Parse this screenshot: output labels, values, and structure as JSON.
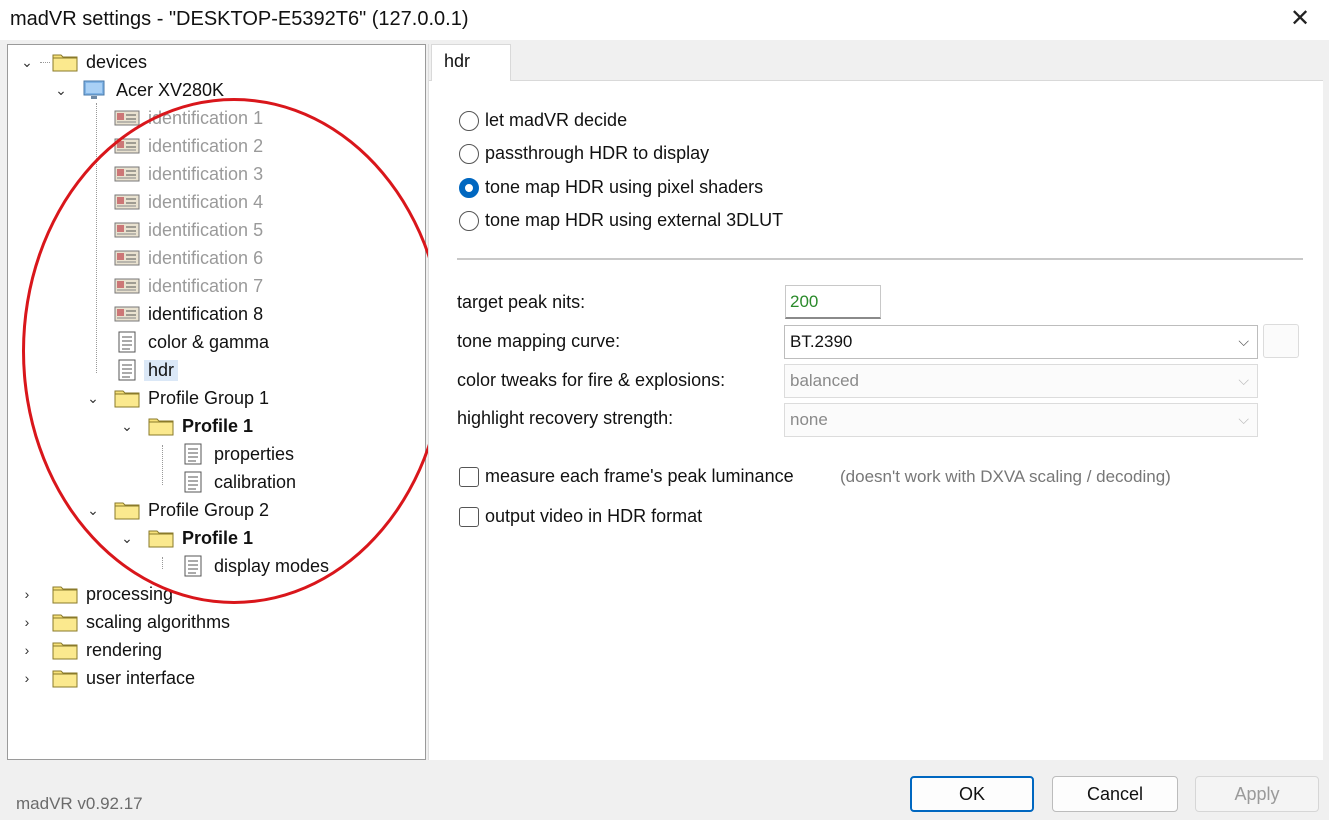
{
  "window": {
    "title": "madVR settings - \"DESKTOP-E5392T6\" (127.0.0.1)",
    "close_glyph": "✕"
  },
  "tree": {
    "devices": "devices",
    "monitor": "Acer XV280K",
    "identifications": [
      "identification 1",
      "identification 2",
      "identification 3",
      "identification 4",
      "identification 5",
      "identification 6",
      "identification 7",
      "identification 8"
    ],
    "color_gamma": "color & gamma",
    "hdr": "hdr",
    "group1": "Profile Group 1",
    "group1_profile": "Profile 1",
    "properties": "properties",
    "calibration": "calibration",
    "group2": "Profile Group 2",
    "group2_profile": "Profile 1",
    "display_modes": "display modes",
    "processing": "processing",
    "scaling": "scaling algorithms",
    "rendering": "rendering",
    "user_interface": "user interface",
    "expanded_glyph": "⌄",
    "collapsed_glyph": "›"
  },
  "panel": {
    "tab_label": "hdr",
    "radios": [
      {
        "label": "let madVR decide",
        "checked": false
      },
      {
        "label": "passthrough HDR to display",
        "checked": false
      },
      {
        "label": "tone map HDR using pixel shaders",
        "checked": true
      },
      {
        "label": "tone map HDR using external 3DLUT",
        "checked": false
      }
    ],
    "target_peak_label": "target peak nits:",
    "target_peak_value": "200",
    "curve_label": "tone mapping curve:",
    "curve_value": "BT.2390",
    "fire_label": "color tweaks for fire & explosions:",
    "fire_value": "balanced",
    "highlight_label": "highlight recovery strength:",
    "highlight_value": "none",
    "measure_label": "measure each frame's peak luminance",
    "measure_checked": false,
    "measure_note": "(doesn't work with DXVA scaling / decoding)",
    "output_label": "output video in HDR format",
    "output_checked": false,
    "chevron_glyph": "⌵"
  },
  "footer": {
    "version": "madVR v0.92.17",
    "ok": "OK",
    "cancel": "Cancel",
    "apply": "Apply"
  },
  "colors": {
    "accent": "#0067c0",
    "annotation_circle": "#d9161b",
    "value_green": "#2a8a2a"
  }
}
